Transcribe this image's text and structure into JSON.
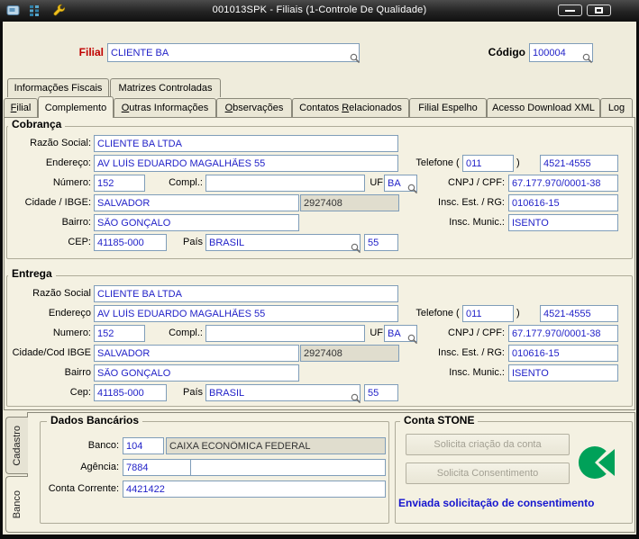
{
  "titlebar": {
    "title": "001013SPK - Filiais (1-Controle De Qualidade)"
  },
  "header": {
    "filial_label": "Filial",
    "filial_value": "CLIENTE BA",
    "codigo_label": "Código",
    "codigo_value": "100004"
  },
  "upper_tabs": [
    {
      "label": "Informações Fiscais"
    },
    {
      "label": "Matrizes Controladas"
    }
  ],
  "main_tabs": [
    {
      "label": "Filial"
    },
    {
      "label": "Complemento",
      "active": true
    },
    {
      "label": "Outras Informações"
    },
    {
      "label": "Observações"
    },
    {
      "label": "Contatos Relacionados"
    },
    {
      "label": "Filial Espelho"
    },
    {
      "label": "Acesso Download XML"
    },
    {
      "label": "Log"
    }
  ],
  "cobranca": {
    "title": "Cobrança",
    "razao_social": {
      "label": "Razão Social:",
      "value": "CLIENTE BA LTDA"
    },
    "endereco": {
      "label": "Endereço:",
      "value": "AV LUÍS EDUARDO MAGALHÃES 55"
    },
    "numero": {
      "label": "Número:",
      "value": "152"
    },
    "compl": {
      "label": "Compl.:",
      "value": ""
    },
    "uf": {
      "label": "UF",
      "value": "BA"
    },
    "cidade": {
      "label": "Cidade / IBGE:",
      "value": "SALVADOR"
    },
    "ibge": {
      "value": "2927408"
    },
    "bairro": {
      "label": "Bairro:",
      "value": "SÃO GONÇALO"
    },
    "cep": {
      "label": "CEP:",
      "value": "41185-000"
    },
    "pais": {
      "label": "País",
      "value": "BRASIL",
      "code": "55"
    },
    "telefone": {
      "label": "Telefone",
      "open": "(",
      "close": ")",
      "ddd": "011",
      "numero": "4521-4555"
    },
    "cnpj": {
      "label": "CNPJ / CPF:",
      "value": "67.177.970/0001-38"
    },
    "insc_est": {
      "label": "Insc. Est. / RG:",
      "value": "010616-15"
    },
    "insc_mun": {
      "label": "Insc. Munic.:",
      "value": "ISENTO"
    }
  },
  "entrega": {
    "title": "Entrega",
    "razao_social": {
      "label": "Razão Social",
      "value": "CLIENTE BA LTDA"
    },
    "endereco": {
      "label": "Endereço",
      "value": "AV LUÍS EDUARDO MAGALHÃES 55"
    },
    "numero": {
      "label": "Numero:",
      "value": "152"
    },
    "compl": {
      "label": "Compl.:",
      "value": ""
    },
    "uf": {
      "label": "UF",
      "value": "BA"
    },
    "cidade": {
      "label": "Cidade/Cod IBGE",
      "value": "SALVADOR"
    },
    "ibge": {
      "value": "2927408"
    },
    "bairro": {
      "label": "Bairro",
      "value": "SÃO GONÇALO"
    },
    "cep": {
      "label": "Cep:",
      "value": "41185-000"
    },
    "pais": {
      "label": "País",
      "value": "BRASIL",
      "code": "55"
    },
    "telefone": {
      "label": "Telefone",
      "open": "(",
      "close": ")",
      "ddd": "011",
      "numero": "4521-4555"
    },
    "cnpj": {
      "label": "CNPJ / CPF:",
      "value": "67.177.970/0001-38"
    },
    "insc_est": {
      "label": "Insc. Est. / RG:",
      "value": "010616-15"
    },
    "insc_mun": {
      "label": "Insc. Munic.:",
      "value": "ISENTO"
    }
  },
  "side_tabs": [
    {
      "label": "Cadastro"
    },
    {
      "label": "Banco",
      "active": true
    }
  ],
  "dados_bancarios": {
    "title": "Dados Bancários",
    "banco": {
      "label": "Banco:",
      "code": "104",
      "name": "CAIXA ECONÔMICA FEDERAL"
    },
    "agencia": {
      "label": "Agência:",
      "value": "7884",
      "extra": ""
    },
    "conta_corrente": {
      "label": "Conta Corrente:",
      "value": "4421422"
    }
  },
  "conta_stone": {
    "title": "Conta STONE",
    "solicita_criacao": "Solicita criação da conta",
    "solicita_consentimento": "Solicita Consentimento",
    "status": "Enviada solicitação de consentimento"
  },
  "colors": {
    "stone_green": "#00A159",
    "input_text_blue": "#2222C8",
    "filial_red": "#C00000",
    "status_blue": "#1515CF"
  },
  "icons": {
    "titlebar": [
      "app-icon",
      "grid-icon",
      "wrench-icon",
      "minimize-icon",
      "maximize-icon"
    ],
    "lookup": "magnifier-icon",
    "stone": "stone-logo-icon"
  }
}
